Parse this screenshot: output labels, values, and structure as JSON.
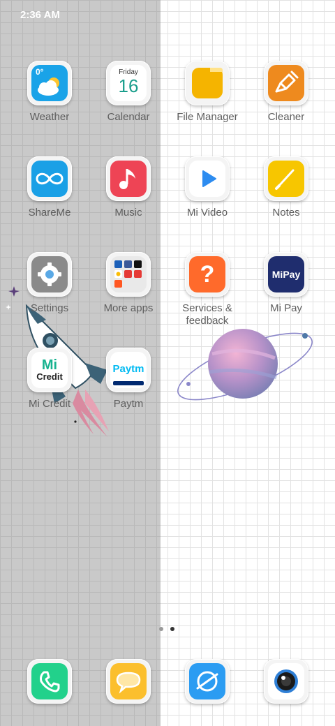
{
  "status_bar": {
    "time": "2:36 AM"
  },
  "apps": {
    "weather": {
      "label": "Weather",
      "temp": "0°"
    },
    "calendar": {
      "label": "Calendar",
      "weekday": "Friday",
      "day": "16"
    },
    "file_manager": {
      "label": "File Manager"
    },
    "cleaner": {
      "label": "Cleaner"
    },
    "shareme": {
      "label": "ShareMe"
    },
    "music": {
      "label": "Music"
    },
    "mi_video": {
      "label": "Mi Video"
    },
    "notes": {
      "label": "Notes"
    },
    "settings": {
      "label": "Settings"
    },
    "more_apps": {
      "label": "More apps"
    },
    "services_feedback": {
      "label": "Services &\nfeedback"
    },
    "mi_pay": {
      "label": "Mi Pay",
      "logo_text": "MiPay"
    },
    "mi_credit": {
      "label": "Mi Credit",
      "logo_top": "Mi",
      "logo_bottom": "Credit"
    },
    "paytm": {
      "label": "Paytm",
      "logo_text": "Paytm"
    }
  },
  "dock": {
    "phone": {
      "icon": "phone-icon"
    },
    "messages": {
      "icon": "message-icon"
    },
    "browser": {
      "icon": "browser-icon"
    },
    "camera": {
      "icon": "camera-icon"
    }
  },
  "page_indicator": {
    "pages": 2,
    "current": 2
  },
  "colors": {
    "weather": "#1aa3e8",
    "file_manager": "#f5b400",
    "cleaner": "#ee8a1e",
    "shareme": "#1aa0e6",
    "music": "#ee4455",
    "mi_video": "#2d8cf0",
    "notes": "#f7c600",
    "settings": "#8a8a8a",
    "services": "#ff6a2b",
    "mi_pay": "#1f2d6e",
    "phone": "#22d18b",
    "messages": "#fbbf2d",
    "browser": "#2b9cf2",
    "camera": "#3a3a3a"
  }
}
